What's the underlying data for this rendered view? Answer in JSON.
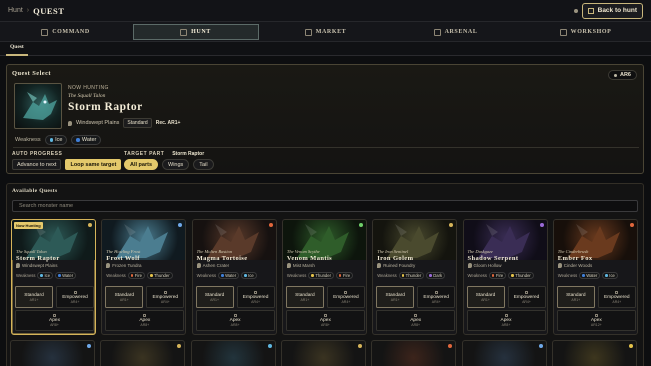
{
  "topbar": {
    "crumb_root": "Hunt",
    "crumb_sep": "›",
    "crumb_current": "QUEST",
    "back_label": "Back to hunt"
  },
  "nav_tabs": [
    {
      "label": "Command",
      "icon": "command-icon",
      "active": false
    },
    {
      "label": "Hunt",
      "icon": "hunt-icon",
      "active": true
    },
    {
      "label": "Market",
      "icon": "market-icon",
      "active": false
    },
    {
      "label": "Arsenal",
      "icon": "arsenal-icon",
      "active": false
    },
    {
      "label": "Workshop",
      "icon": "workshop-icon",
      "active": false
    }
  ],
  "subtab": {
    "label": "Quest"
  },
  "quest_select": {
    "title": "Quest Select",
    "rank": "AR6",
    "now_label": "NOW HUNTING",
    "subtitle": "The Squall Talon",
    "name": "Storm Raptor",
    "location": "Windswept Plains",
    "difficulty": "Standard",
    "rec": "Rec. AR1+",
    "weakness_label": "Weakness",
    "weaknesses": [
      {
        "name": "Ice",
        "color": "#5fb7e0"
      },
      {
        "name": "Water",
        "color": "#3f7fd8"
      }
    ],
    "auto_progress_label": "AUTO PROGRESS",
    "auto_options": [
      {
        "label": "Advance to next",
        "on": false
      },
      {
        "label": "Loop same target",
        "on": true
      }
    ],
    "target_part_label": "TARGET PART",
    "target_part_value": "Storm Raptor",
    "part_options": [
      {
        "label": "All parts",
        "on": true
      },
      {
        "label": "Wings",
        "on": false
      },
      {
        "label": "Tail",
        "on": false
      }
    ]
  },
  "available": {
    "title": "Available Quests",
    "search_placeholder": "Search monster name",
    "now_hunting_tag": "Now Hunting",
    "difficulties": {
      "standard": "Standard",
      "standard_rank": "AR1+",
      "empowered": "Empowered",
      "apex": "Apex"
    },
    "cards": [
      {
        "subtitle": "The Squall Talon",
        "name": "Storm Raptor",
        "location": "Windswept Plains",
        "weak": [
          {
            "n": "Ice",
            "c": "#5fb7e0"
          },
          {
            "n": "Water",
            "c": "#3f7fd8"
          }
        ],
        "emp_rank": "AR4+",
        "apex_rank": "AR8+",
        "selected": true,
        "dot": "#d5b45a",
        "art": [
          "#2d5a57",
          "#0f1a1a"
        ]
      },
      {
        "subtitle": "The Howling Frost",
        "name": "Frost Wolf",
        "location": "Frozen Tundra",
        "weak": [
          {
            "n": "Fire",
            "c": "#e0673c"
          },
          {
            "n": "Thunder",
            "c": "#e4c24a"
          }
        ],
        "emp_rank": "AR4+",
        "apex_rank": "AR8+",
        "selected": false,
        "dot": "#6fa8e8",
        "art": [
          "#4b7d90",
          "#101a20"
        ]
      },
      {
        "subtitle": "The Molten Bastion",
        "name": "Magma Tortoise",
        "location": "Ashen Crater",
        "weak": [
          {
            "n": "Water",
            "c": "#3f7fd8"
          },
          {
            "n": "Ice",
            "c": "#5fb7e0"
          }
        ],
        "emp_rank": "AR4+",
        "apex_rank": "AR8+",
        "selected": false,
        "dot": "#e0673c",
        "art": [
          "#5a3a2a",
          "#161110"
        ]
      },
      {
        "subtitle": "The Venom Scythe",
        "name": "Venom Mantis",
        "location": "Mist Marsh",
        "weak": [
          {
            "n": "Thunder",
            "c": "#e4c24a"
          },
          {
            "n": "Fire",
            "c": "#e0673c"
          }
        ],
        "emp_rank": "AR4+",
        "apex_rank": "AR8+",
        "selected": false,
        "dot": "#6fcf6a",
        "art": [
          "#2f5d2a",
          "#0d150c"
        ]
      },
      {
        "subtitle": "The Iron Sentinel",
        "name": "Iron Golem",
        "location": "Ruined Foundry",
        "weak": [
          {
            "n": "Thunder",
            "c": "#e4c24a"
          },
          {
            "n": "Dark",
            "c": "#9a6ad8"
          }
        ],
        "emp_rank": "AR4+",
        "apex_rank": "AR8+",
        "selected": false,
        "dot": "#d5b45a",
        "art": [
          "#4a4a2e",
          "#14140e"
        ]
      },
      {
        "subtitle": "The Duskgaze",
        "name": "Shadow Serpent",
        "location": "Gloom Hollow",
        "weak": [
          {
            "n": "Fire",
            "c": "#e0673c"
          },
          {
            "n": "Thunder",
            "c": "#e4c24a"
          }
        ],
        "emp_rank": "AR4+",
        "apex_rank": "AR8+",
        "selected": false,
        "dot": "#9a6ad8",
        "art": [
          "#3a2d55",
          "#100d18"
        ]
      },
      {
        "subtitle": "The Cinderbrush",
        "name": "Ember Fox",
        "location": "Cinder Woods",
        "weak": [
          {
            "n": "Water",
            "c": "#3f7fd8"
          },
          {
            "n": "Ice",
            "c": "#5fb7e0"
          }
        ],
        "emp_rank": "AR4+",
        "apex_rank": "AR12+",
        "selected": false,
        "dot": "#e0673c",
        "art": [
          "#6a3a1e",
          "#170f0a"
        ]
      }
    ],
    "second_row_dots": [
      "#6fa8e8",
      "#d5b45a",
      "#5fb7e0",
      "#d5b45a",
      "#e0673c",
      "#6fa8e8",
      "#e4c24a"
    ]
  }
}
